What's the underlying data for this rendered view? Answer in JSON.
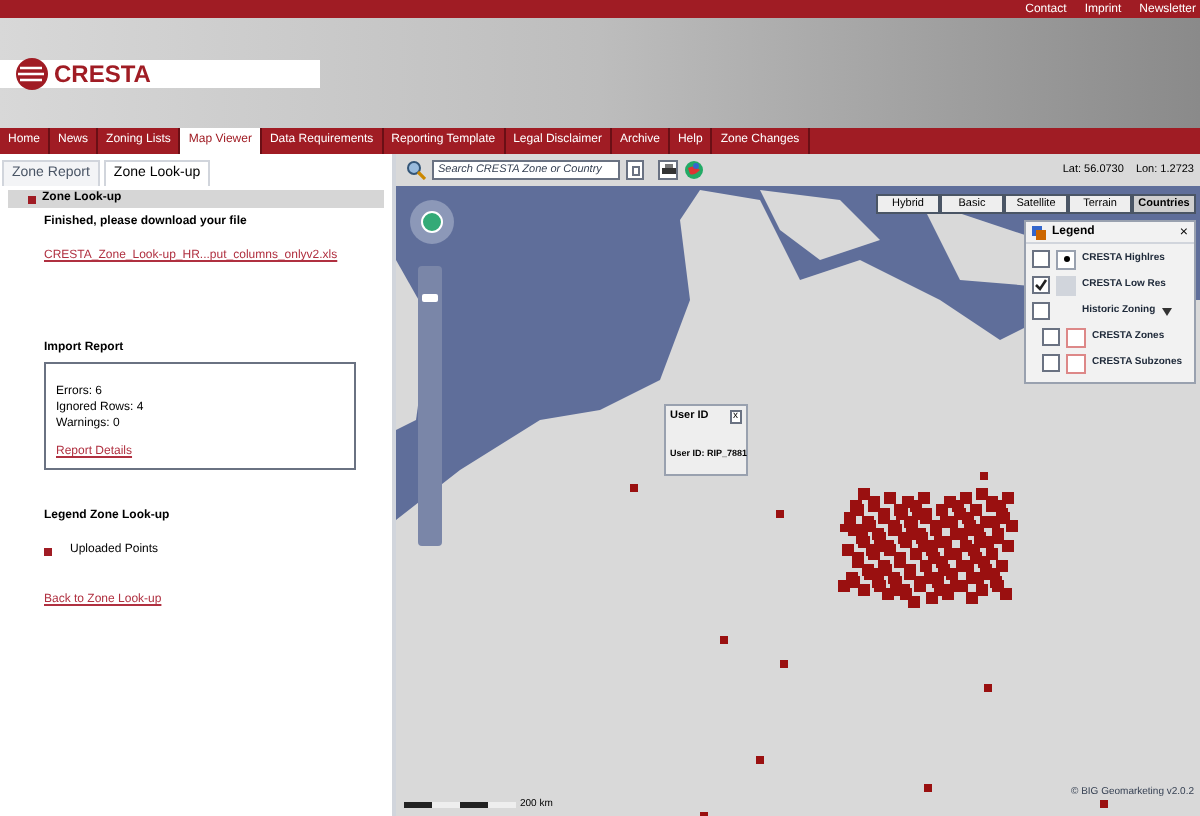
{
  "top_links": [
    "Contact",
    "Imprint",
    "Newsletter"
  ],
  "logo": {
    "text": "CRESTA"
  },
  "nav": [
    {
      "label": "Home",
      "selected": false
    },
    {
      "label": "News",
      "selected": false
    },
    {
      "label": "Zoning Lists",
      "selected": false
    },
    {
      "label": "Map Viewer",
      "selected": true
    },
    {
      "label": "Data Requirements",
      "selected": false
    },
    {
      "label": "Reporting Template",
      "selected": false
    },
    {
      "label": "Legal Disclaimer",
      "selected": false
    },
    {
      "label": "Archive",
      "selected": false
    },
    {
      "label": "Help",
      "selected": false
    },
    {
      "label": "Zone Changes",
      "selected": false
    }
  ],
  "panel_tabs": [
    {
      "label": "Zone Report",
      "selected": false
    },
    {
      "label": "Zone Look-up",
      "selected": true
    }
  ],
  "panel": {
    "title": "Zone Look-up",
    "message": "Finished, please download your file",
    "file_link": "CRESTA_Zone_Look-up_HR...put_columns_onlyv2.xls",
    "import_report": {
      "title": "Import Report",
      "lines": [
        "Errors: 6",
        "Ignored Rows: 4",
        "Warnings: 0"
      ],
      "link": "Report Details"
    },
    "legend": {
      "title": "Legend Zone Look-up",
      "items": [
        {
          "label": "Uploaded Points",
          "color": "#a01c24"
        }
      ]
    },
    "back_link": "Back to Zone Look-up"
  },
  "map_toolbar": {
    "search_placeholder": "Search CRESTA Zone or Country",
    "lat": "Lat: 56.0730",
    "lon": "Lon: 1.2723"
  },
  "map_types": [
    {
      "label": "Hybrid",
      "selected": false
    },
    {
      "label": "Basic",
      "selected": false
    },
    {
      "label": "Satellite",
      "selected": false
    },
    {
      "label": "Terrain",
      "selected": false
    },
    {
      "label": "Countries",
      "selected": true
    }
  ],
  "map_legend": {
    "title": "Legend",
    "close": "×",
    "items": [
      {
        "kind": "dot",
        "label": "CRESTA Highlres",
        "checked": false
      },
      {
        "kind": "fill",
        "label": "CRESTA Low Res",
        "checked": true
      },
      {
        "kind": "group",
        "label": "Historic Zoning",
        "checked": false,
        "expanded": true,
        "children": [
          {
            "kind": "outline",
            "label": "CRESTA Zones",
            "checked": false
          },
          {
            "kind": "outline",
            "label": "CRESTA Subzones",
            "checked": false
          }
        ]
      }
    ]
  },
  "zoom_slider": {
    "level": 0.9
  },
  "popup": {
    "title": "User ID",
    "close": "x",
    "text": "User ID: RIP_7881"
  },
  "scale": {
    "label": "200 km"
  },
  "copyright": "© BIG Geomarketing v2.0.2"
}
